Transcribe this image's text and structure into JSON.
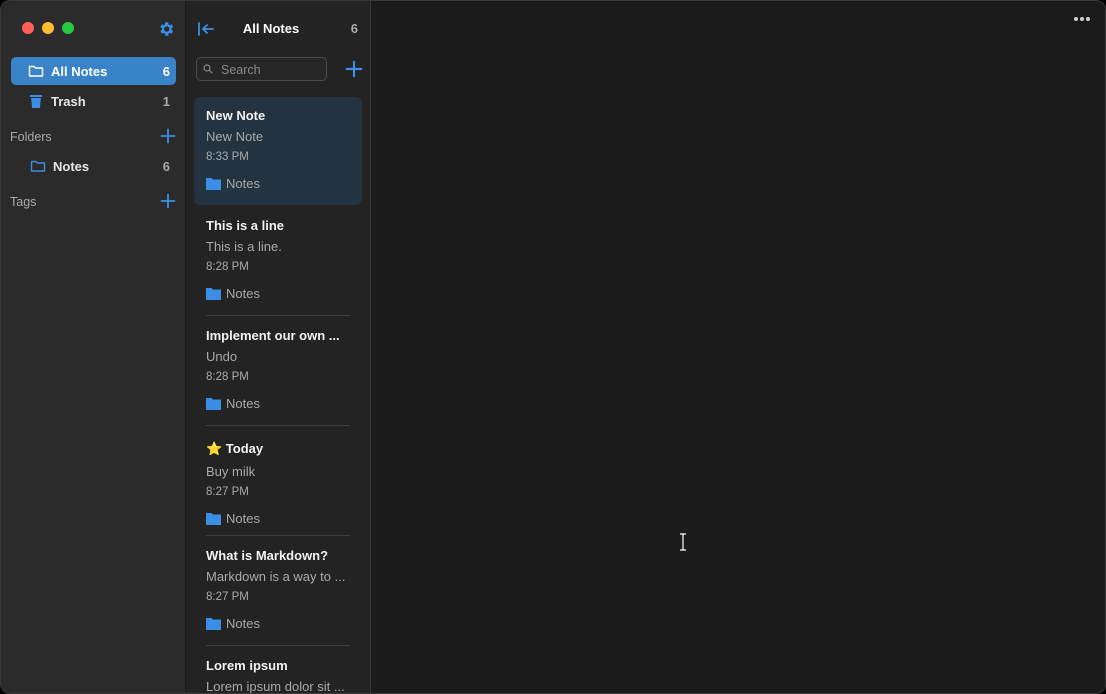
{
  "sidebar": {
    "items": [
      {
        "label": "All Notes",
        "count": "6",
        "icon": "folder-outline-icon",
        "active": true
      },
      {
        "label": "Trash",
        "count": "1",
        "icon": "trash-icon",
        "active": false
      }
    ],
    "folders_header": "Folders",
    "folders": [
      {
        "label": "Notes",
        "count": "6",
        "icon": "folder-outline-icon"
      }
    ],
    "tags_header": "Tags"
  },
  "notelist": {
    "title": "All Notes",
    "count": "6",
    "search_placeholder": "Search",
    "notes": [
      {
        "title": "New Note",
        "preview": "New Note",
        "time": "8:33 PM",
        "folder": "Notes"
      },
      {
        "title": "This is a line",
        "preview": "This is a line.",
        "time": "8:28 PM",
        "folder": "Notes"
      },
      {
        "title": "Implement our own ...",
        "preview": "Undo",
        "time": "8:28 PM",
        "folder": "Notes"
      },
      {
        "title": "⭐ Today",
        "preview": "Buy milk",
        "time": "8:27 PM",
        "folder": "Notes"
      },
      {
        "title": "What is Markdown?",
        "preview": "Markdown is a way to ...",
        "time": "8:27 PM",
        "folder": "Notes"
      },
      {
        "title": "Lorem ipsum",
        "preview": "Lorem ipsum dolor sit ...",
        "time": "",
        "folder": ""
      }
    ]
  },
  "colors": {
    "accent": "#3b83c9",
    "folder_blue": "#3a8ee6",
    "selected_note_bg": "#233340"
  }
}
